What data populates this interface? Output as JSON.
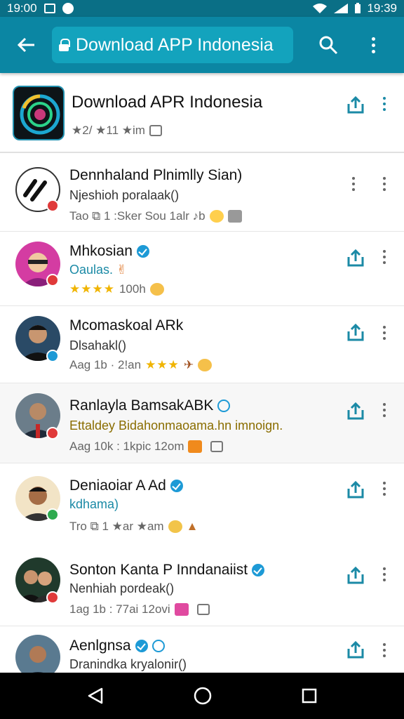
{
  "status_bar": {
    "time_left": "19:00",
    "time_right": "19:39"
  },
  "app_bar": {
    "url_text": "Download APP Indonesia"
  },
  "header_app": {
    "title": "Download APR Indonesia",
    "meta": "★2/ ★11 ★im"
  },
  "rows": [
    {
      "title": "Dennhaland Plnimlly Sian)",
      "subtitle": "Njeshioh poralaak()",
      "meta": "Tao  ⧉  1 :Sker Sou 1alr ♪b"
    },
    {
      "title": "Mhkosian",
      "subtitle": "Oaulas.",
      "meta_stars": "★★★★",
      "meta": "100h"
    },
    {
      "title": "Mcomaskoal ARk",
      "subtitle": "Dlsahakl()",
      "meta": "Aag  1b  · 2!an",
      "meta_stars": "★★★"
    },
    {
      "title": "Ranlayla BamsakABK",
      "subtitle": "Ettaldey Bidahonmaoama.hn imnoign.",
      "meta": "Aag  10k : 1kpic 12om"
    },
    {
      "title": "Deniaoiar A Ad",
      "subtitle": "kdhama)",
      "meta": "Tro  ⧉ 1 ★ar  ★am"
    },
    {
      "title": "Sonton Kanta P Inndanaiist",
      "subtitle": "Nenhiah pordeak()",
      "meta": "1ag  1b : 77ai 12ovi"
    },
    {
      "title": "Aenlgnsa",
      "subtitle": "Dranindka kryalonir()"
    }
  ],
  "colors": {
    "appbar": "#0b86a3",
    "statusbar": "#0a6f86",
    "accent": "#1b8aa6",
    "verified": "#1d9ad6"
  }
}
